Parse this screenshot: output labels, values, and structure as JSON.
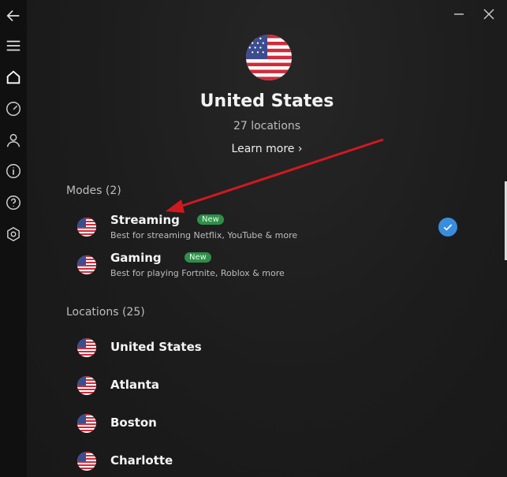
{
  "country": {
    "title": "United States",
    "subtitle": "27 locations",
    "learn_more": "Learn more ›",
    "flag_icon": "us-flag-icon"
  },
  "modes": {
    "heading": "Modes (2)",
    "items": [
      {
        "name": "Streaming",
        "badge": "New",
        "description": "Best for streaming Netflix, YouTube & more",
        "selected": true
      },
      {
        "name": "Gaming",
        "badge": "New",
        "description": "Best for playing Fortnite, Roblox & more",
        "selected": false
      }
    ]
  },
  "locations": {
    "heading": "Locations (25)",
    "items": [
      {
        "name": "United States"
      },
      {
        "name": "Atlanta"
      },
      {
        "name": "Boston"
      },
      {
        "name": "Charlotte"
      }
    ]
  },
  "sidebar": {
    "items": [
      {
        "icon": "back-arrow-icon"
      },
      {
        "icon": "menu-icon"
      },
      {
        "icon": "home-icon",
        "active": true
      },
      {
        "icon": "speed-gauge-icon"
      },
      {
        "icon": "account-icon"
      },
      {
        "icon": "info-icon"
      },
      {
        "icon": "help-icon"
      },
      {
        "icon": "settings-icon"
      }
    ]
  },
  "window": {
    "minimize_icon": "minimize-icon",
    "close_icon": "close-icon"
  },
  "colors": {
    "accent": "#3a8dde",
    "badge": "#2f8f4a",
    "annotation_arrow": "#d0191f"
  }
}
